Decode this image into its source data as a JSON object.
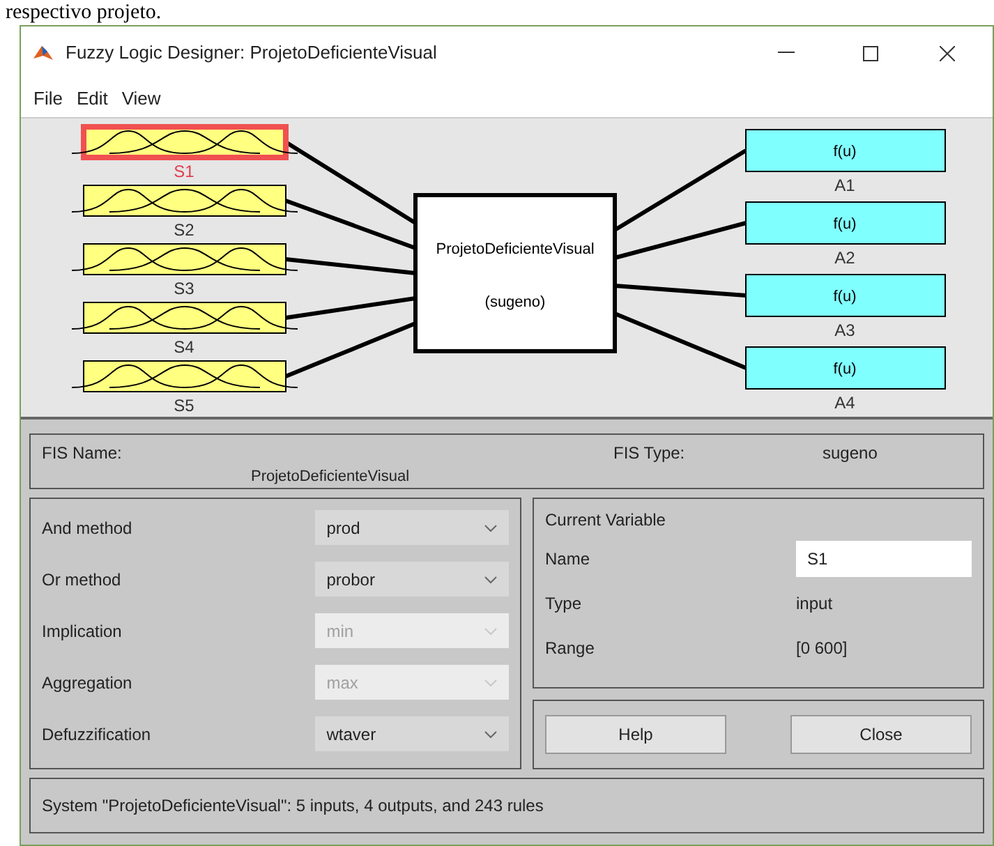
{
  "document_text": "respectivo projeto.",
  "window": {
    "title": "Fuzzy Logic Designer: ProjetoDeficienteVisual"
  },
  "menu": [
    "File",
    "Edit",
    "View"
  ],
  "diagram": {
    "inputs": [
      {
        "label": "S1",
        "selected": true
      },
      {
        "label": "S2",
        "selected": false
      },
      {
        "label": "S3",
        "selected": false
      },
      {
        "label": "S4",
        "selected": false
      },
      {
        "label": "S5",
        "selected": false
      }
    ],
    "system": {
      "name": "ProjetoDeficienteVisual",
      "type": "(sugeno)"
    },
    "outputs": [
      {
        "label": "A1",
        "function": "f(u)"
      },
      {
        "label": "A2",
        "function": "f(u)"
      },
      {
        "label": "A3",
        "function": "f(u)"
      },
      {
        "label": "A4",
        "function": "f(u)"
      }
    ]
  },
  "fis": {
    "name_label": "FIS Name:",
    "name": "ProjetoDeficienteVisual",
    "type_label": "FIS Type:",
    "type": "sugeno"
  },
  "methods": [
    {
      "label": "And method",
      "value": "prod",
      "disabled": false
    },
    {
      "label": "Or method",
      "value": "probor",
      "disabled": false
    },
    {
      "label": "Implication",
      "value": "min",
      "disabled": true
    },
    {
      "label": "Aggregation",
      "value": "max",
      "disabled": true
    },
    {
      "label": "Defuzzification",
      "value": "wtaver",
      "disabled": false
    }
  ],
  "current_variable": {
    "title": "Current Variable",
    "fields": [
      {
        "kind": "field",
        "label": "Name",
        "value": "S1"
      },
      {
        "kind": "text",
        "label": "Type",
        "value": "input"
      },
      {
        "kind": "text",
        "label": "Range",
        "value": "[0 600]"
      }
    ]
  },
  "buttons": [
    "Help",
    "Close"
  ],
  "status": "System \"ProjetoDeficienteVisual\": 5 inputs, 4 outputs, and 243 rules"
}
